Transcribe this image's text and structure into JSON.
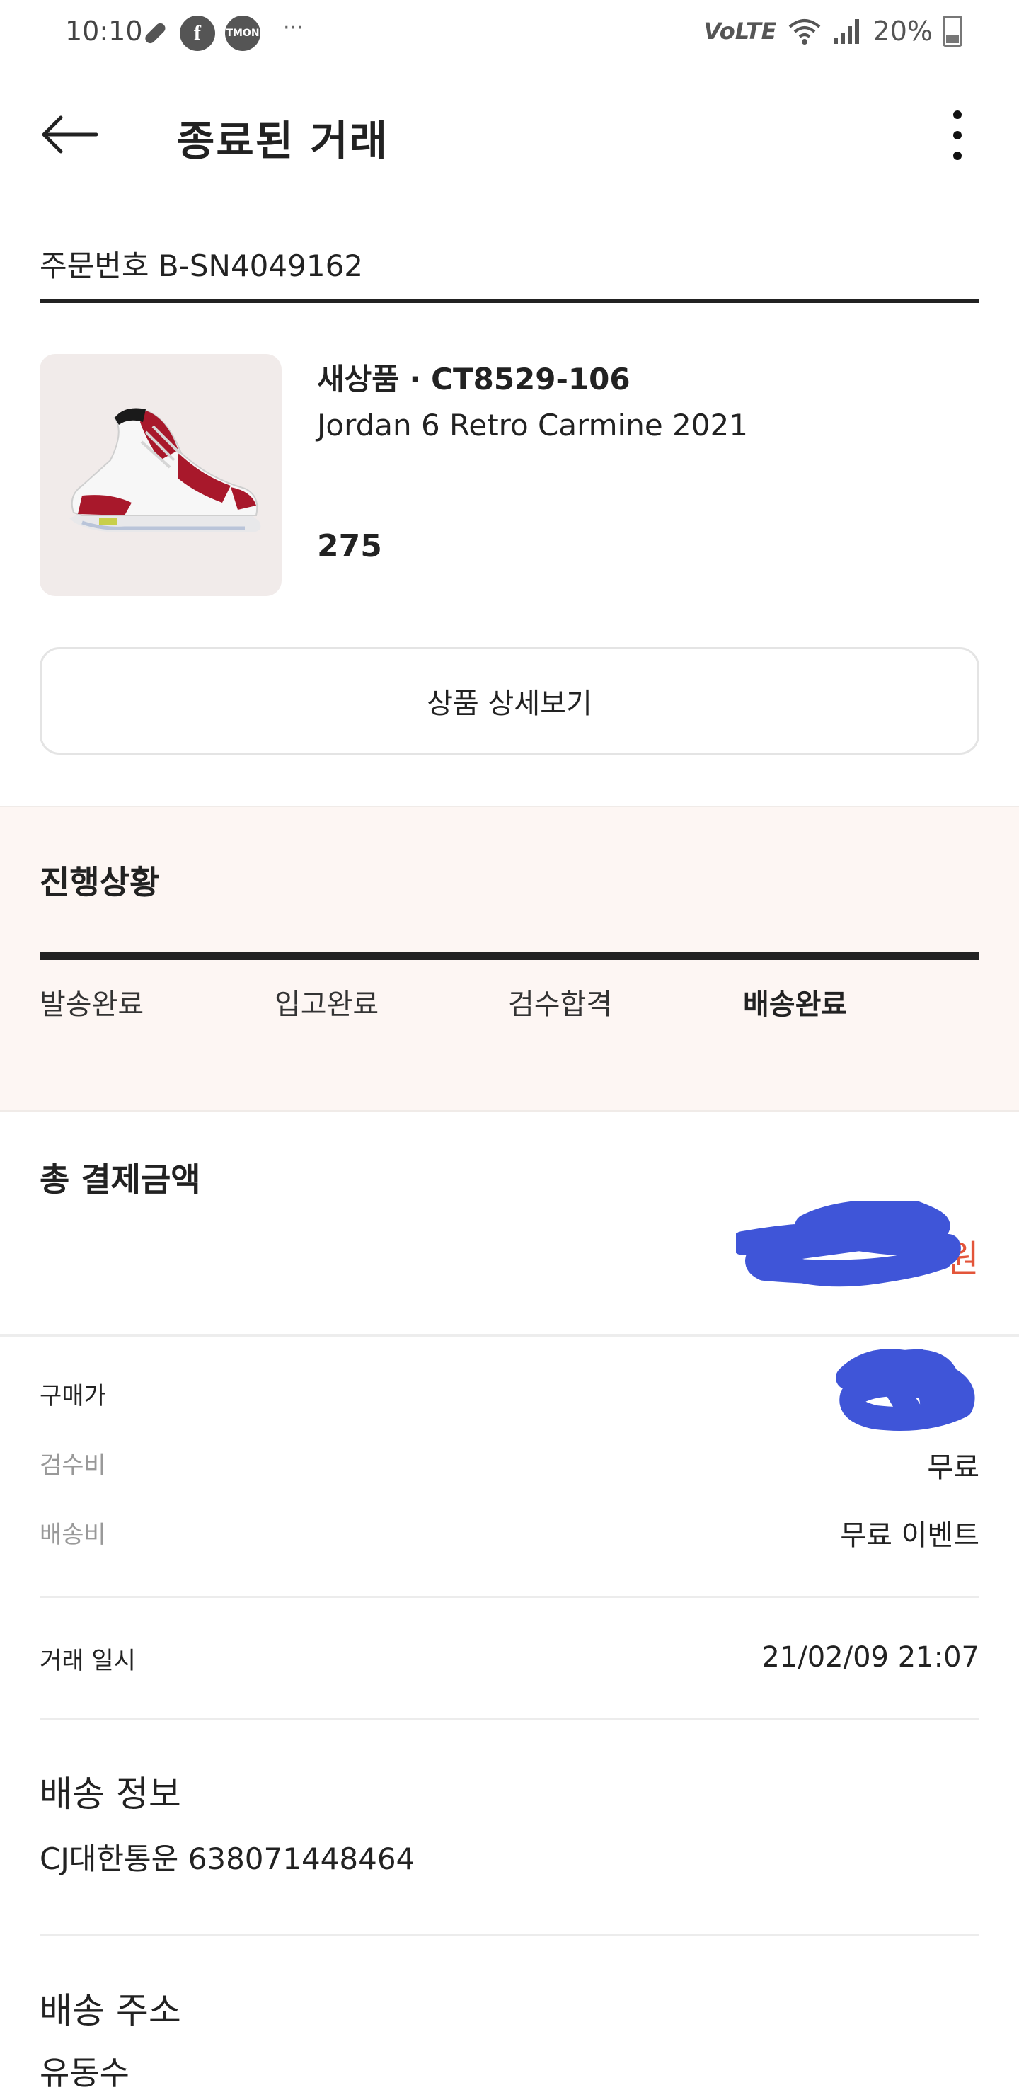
{
  "status_bar": {
    "time": "10:10",
    "icons": [
      "pill-icon",
      "facebook-icon",
      "tmon-icon"
    ],
    "tmon_label": "TMON",
    "more": "···",
    "volte": "VoLTE",
    "battery": "20%"
  },
  "header": {
    "title": "종료된 거래"
  },
  "order": {
    "number": "주문번호 B-SN4049162"
  },
  "product": {
    "meta": "새상품 · CT8529-106",
    "name": "Jordan 6 Retro Carmine 2021",
    "size": "275",
    "detail_button": "상품 상세보기"
  },
  "progress": {
    "title": "진행상황",
    "steps": [
      "발송완료",
      "입고완료",
      "검수합격",
      "배송완료"
    ],
    "active_index": 3
  },
  "payment": {
    "title": "총 결제금액",
    "total_suffix": "원",
    "rows": [
      {
        "label": "구매가",
        "value": ""
      },
      {
        "label": "검수비",
        "value": "무료"
      },
      {
        "label": "배송비",
        "value": "무료 이벤트"
      }
    ]
  },
  "trade": {
    "label": "거래 일시",
    "value": "21/02/09 21:07"
  },
  "shipping": {
    "title": "배송 정보",
    "value": "CJ대한통운 638071448464"
  },
  "address": {
    "title": "배송 주소",
    "name": "유동수"
  },
  "colors": {
    "accent_red": "#e3553a",
    "redaction_blue": "#3f55d8",
    "progress_bg": "#fdf6f3",
    "image_bg": "#f1ebea"
  }
}
